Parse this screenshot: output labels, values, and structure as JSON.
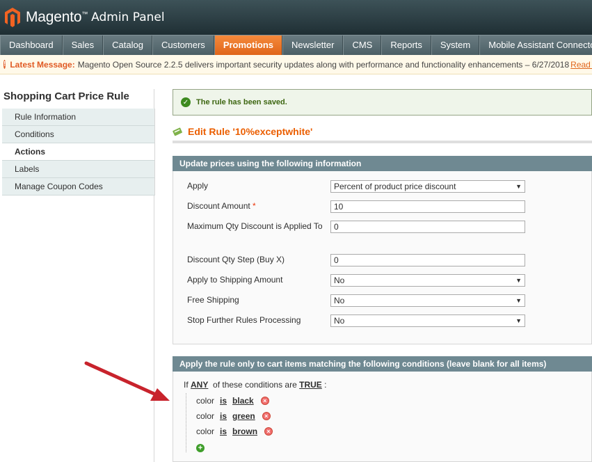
{
  "header": {
    "brand": "Magento",
    "brand_tm": "™",
    "subtitle": "Admin Panel"
  },
  "nav": {
    "items": [
      {
        "label": "Dashboard",
        "active": false
      },
      {
        "label": "Sales",
        "active": false
      },
      {
        "label": "Catalog",
        "active": false
      },
      {
        "label": "Customers",
        "active": false
      },
      {
        "label": "Promotions",
        "active": true
      },
      {
        "label": "Newsletter",
        "active": false
      },
      {
        "label": "CMS",
        "active": false
      },
      {
        "label": "Reports",
        "active": false
      },
      {
        "label": "System",
        "active": false
      },
      {
        "label": "Mobile Assistant Connector",
        "active": false
      }
    ]
  },
  "notice": {
    "label": "Latest Message:",
    "text": "Magento Open Source 2.2.5 delivers important security updates along with performance and functionality enhancements – 6/27/2018",
    "link": "Read details"
  },
  "sidebar": {
    "title": "Shopping Cart Price Rule",
    "items": [
      {
        "label": "Rule Information",
        "active": false
      },
      {
        "label": "Conditions",
        "active": false
      },
      {
        "label": "Actions",
        "active": true
      },
      {
        "label": "Labels",
        "active": false
      },
      {
        "label": "Manage Coupon Codes",
        "active": false
      }
    ]
  },
  "main": {
    "success": "The rule has been saved.",
    "edit_title": "Edit Rule '10%exceptwhite'",
    "prices_box": {
      "title": "Update prices using the following information",
      "fields": [
        {
          "label": "Apply",
          "value": "Percent of product price discount",
          "type": "select",
          "required": false
        },
        {
          "label": "Discount Amount",
          "value": "10",
          "type": "input",
          "required": true
        },
        {
          "label": "Maximum Qty Discount is Applied To",
          "value": "0",
          "type": "input",
          "required": false
        },
        {
          "label": "Discount Qty Step (Buy X)",
          "value": "0",
          "type": "input",
          "required": false
        },
        {
          "label": "Apply to Shipping Amount",
          "value": "No",
          "type": "select",
          "required": false
        },
        {
          "label": "Free Shipping",
          "value": "No",
          "type": "select",
          "required": false
        },
        {
          "label": "Stop Further Rules Processing",
          "value": "No",
          "type": "select",
          "required": false
        }
      ]
    },
    "conditions_box": {
      "title": "Apply the rule only to cart items matching the following conditions (leave blank for all items)",
      "if_text": "If",
      "any": "ANY",
      "middle_text": "of these conditions are",
      "truth": "TRUE",
      "colon": ":",
      "conditions": [
        {
          "attribute": "color",
          "operator": "is",
          "value": "black"
        },
        {
          "attribute": "color",
          "operator": "is",
          "value": "green"
        },
        {
          "attribute": "color",
          "operator": "is",
          "value": "brown"
        }
      ]
    }
  },
  "colors": {
    "accent": "#eb5e00",
    "nav_active": "#e0651a",
    "box_header": "#6f8992",
    "arrow": "#c8232c"
  },
  "icons": {
    "logo": "magento-logo-icon",
    "notice": "warning-icon",
    "success": "check-icon",
    "edit": "pencil-icon",
    "remove": "remove-icon",
    "add": "add-icon",
    "dropdown": "chevron-down-icon",
    "annotation": "red-arrow-icon"
  }
}
